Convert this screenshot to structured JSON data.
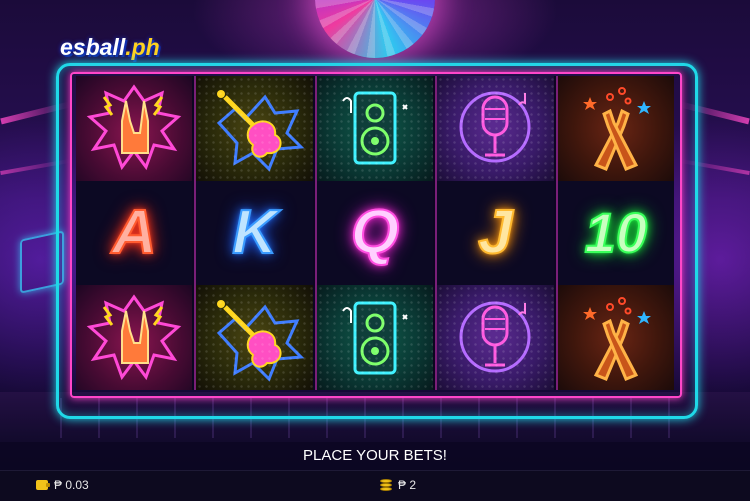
{
  "logo": {
    "text": "esball",
    "suffix": ".ph"
  },
  "reels": [
    {
      "top": "rock-hand",
      "middle": "A",
      "bottom": "rock-hand"
    },
    {
      "top": "electric-guitar",
      "middle": "K",
      "bottom": "electric-guitar"
    },
    {
      "top": "speaker",
      "middle": "Q",
      "bottom": "speaker"
    },
    {
      "top": "microphone",
      "middle": "J",
      "bottom": "microphone"
    },
    {
      "top": "beer-bottles",
      "middle": "10",
      "bottom": "beer-bottles"
    }
  ],
  "status_message": "PLACE YOUR BETS!",
  "balance": {
    "value": "₱ 0.03"
  },
  "bet": {
    "value": "₱ 2"
  },
  "colors": {
    "frame_outer": "#1fd9e8",
    "frame_inner": "#ff46c9"
  }
}
